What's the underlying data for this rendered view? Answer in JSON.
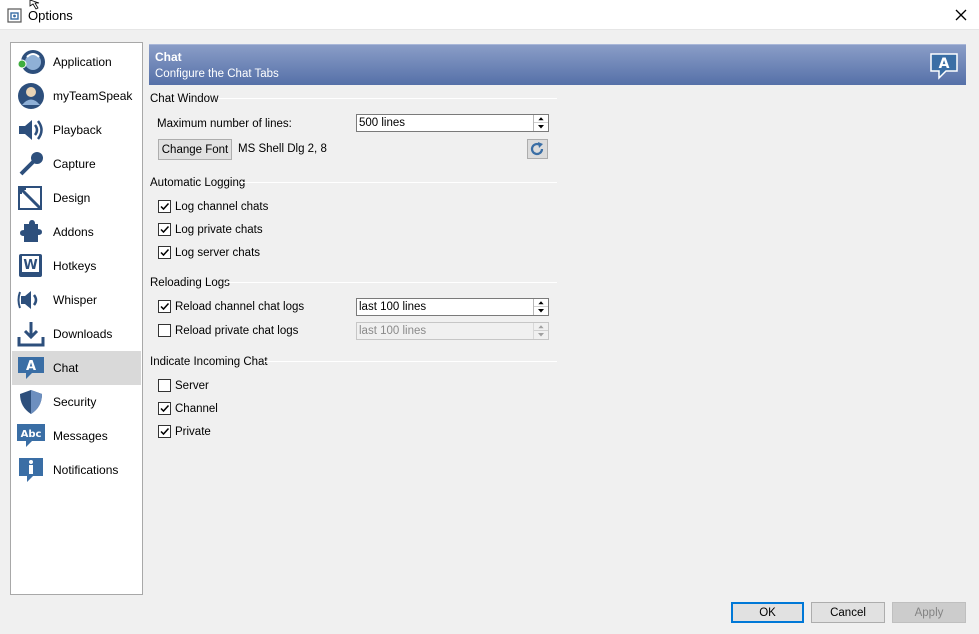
{
  "window": {
    "title": "Options"
  },
  "sidebar": {
    "items": [
      {
        "label": "Application",
        "icon": "application-icon"
      },
      {
        "label": "myTeamSpeak",
        "icon": "user-profile-icon"
      },
      {
        "label": "Playback",
        "icon": "speaker-icon"
      },
      {
        "label": "Capture",
        "icon": "microphone-icon"
      },
      {
        "label": "Design",
        "icon": "design-icon"
      },
      {
        "label": "Addons",
        "icon": "puzzle-icon"
      },
      {
        "label": "Hotkeys",
        "icon": "keyboard-key-icon"
      },
      {
        "label": "Whisper",
        "icon": "whisper-icon"
      },
      {
        "label": "Downloads",
        "icon": "download-icon"
      },
      {
        "label": "Chat",
        "icon": "chat-bubble-icon"
      },
      {
        "label": "Security",
        "icon": "shield-icon"
      },
      {
        "label": "Messages",
        "icon": "messages-icon"
      },
      {
        "label": "Notifications",
        "icon": "info-icon"
      }
    ],
    "selected": "Chat"
  },
  "header": {
    "title": "Chat",
    "subtitle": "Configure the Chat Tabs"
  },
  "chat_window": {
    "title": "Chat Window",
    "max_lines_label": "Maximum number of lines:",
    "max_lines_value": "500 lines",
    "change_font_label": "Change Font",
    "font_value": "MS Shell Dlg 2, 8"
  },
  "automatic_logging": {
    "title": "Automatic Logging",
    "options": [
      {
        "label": "Log channel chats",
        "checked": true
      },
      {
        "label": "Log private chats",
        "checked": true
      },
      {
        "label": "Log server chats",
        "checked": true
      }
    ]
  },
  "reloading_logs": {
    "title": "Reloading Logs",
    "channel_label": "Reload channel chat logs",
    "channel_checked": true,
    "channel_value": "last 100 lines",
    "private_label": "Reload private chat logs",
    "private_checked": false,
    "private_value": "last 100 lines"
  },
  "indicate_incoming": {
    "title": "Indicate Incoming Chat",
    "options": [
      {
        "label": "Server",
        "checked": false
      },
      {
        "label": "Channel",
        "checked": true
      },
      {
        "label": "Private",
        "checked": true
      }
    ]
  },
  "footer": {
    "ok_label": "OK",
    "cancel_label": "Cancel",
    "apply_label": "Apply"
  },
  "colors": {
    "header_top": "#8a9dc7",
    "header_bottom": "#5570a8",
    "selected_item": "#d9d9d9",
    "default_button_border": "#0078d7"
  }
}
